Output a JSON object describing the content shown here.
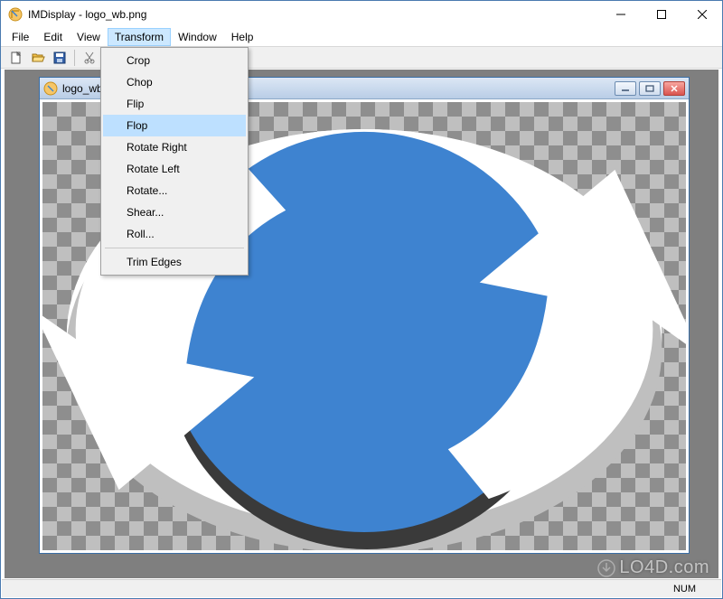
{
  "window": {
    "title": "IMDisplay - logo_wb.png"
  },
  "menubar": {
    "items": [
      "File",
      "Edit",
      "View",
      "Transform",
      "Window",
      "Help"
    ],
    "open_index": 3
  },
  "toolbar": {
    "buttons": [
      "new",
      "open",
      "save",
      "cut"
    ]
  },
  "dropdown": {
    "items": [
      {
        "label": "Crop",
        "type": "item"
      },
      {
        "label": "Chop",
        "type": "item"
      },
      {
        "label": "Flip",
        "type": "item"
      },
      {
        "label": "Flop",
        "type": "item",
        "highlight": true
      },
      {
        "label": "Rotate Right",
        "type": "item"
      },
      {
        "label": "Rotate Left",
        "type": "item"
      },
      {
        "label": "Rotate...",
        "type": "item"
      },
      {
        "label": "Shear...",
        "type": "item"
      },
      {
        "label": "Roll...",
        "type": "item"
      },
      {
        "type": "sep"
      },
      {
        "label": "Trim Edges",
        "type": "item"
      }
    ]
  },
  "document": {
    "filename": "logo_wb.png"
  },
  "statusbar": {
    "num": "NUM"
  },
  "watermark": {
    "text": "LO4D.com"
  },
  "colors": {
    "accent_blue": "#3e83d0",
    "highlight": "#bde0ff"
  }
}
